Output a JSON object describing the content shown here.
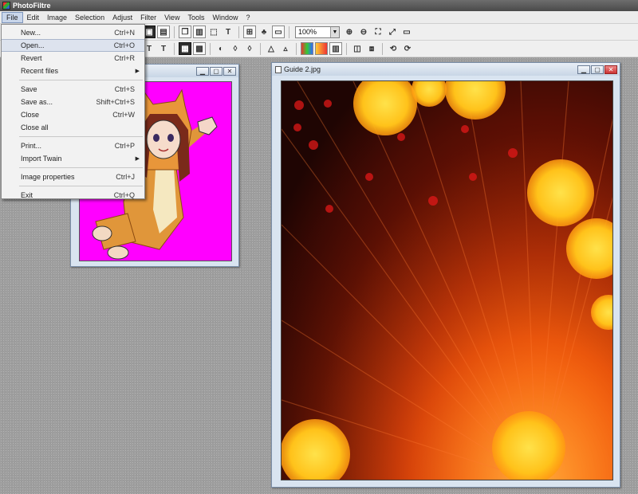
{
  "app": {
    "title": "PhotoFiltre"
  },
  "menubar": {
    "items": [
      "File",
      "Edit",
      "Image",
      "Selection",
      "Adjust",
      "Filter",
      "View",
      "Tools",
      "Window",
      "?"
    ]
  },
  "toolbar": {
    "zoom_value": "100%"
  },
  "file_menu": {
    "new": {
      "label": "New...",
      "shortcut": "Ctrl+N"
    },
    "open": {
      "label": "Open...",
      "shortcut": "Ctrl+O"
    },
    "revert": {
      "label": "Revert",
      "shortcut": "Ctrl+R"
    },
    "recent": {
      "label": "Recent files"
    },
    "save": {
      "label": "Save",
      "shortcut": "Ctrl+S"
    },
    "save_as": {
      "label": "Save as...",
      "shortcut": "Shift+Ctrl+S"
    },
    "close": {
      "label": "Close",
      "shortcut": "Ctrl+W"
    },
    "close_all": {
      "label": "Close all"
    },
    "print": {
      "label": "Print...",
      "shortcut": "Ctrl+P"
    },
    "import_twain": {
      "label": "Import Twain"
    },
    "image_properties": {
      "label": "Image properties",
      "shortcut": "Ctrl+J"
    },
    "exit": {
      "label": "Exit",
      "shortcut": "Ctrl+Q"
    }
  },
  "documents": {
    "photo": {
      "title": "Guide 2.jpg"
    }
  },
  "colors": {
    "canvas_magenta": "#ff00ff",
    "workspace": "#9e9e9e",
    "menu_highlight": "#dde3ee"
  }
}
